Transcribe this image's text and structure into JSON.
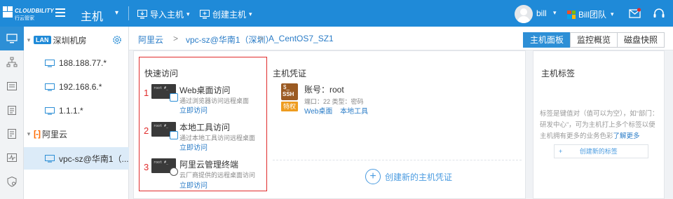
{
  "brand": {
    "name": "CLOUDBILITY",
    "sub": "行云管家"
  },
  "header": {
    "module": "主机",
    "import_host": "导入主机",
    "create_host": "创建主机",
    "user": "bill",
    "team": "Bill团队"
  },
  "tree": {
    "lan_badge": "LAN",
    "lan_group": "深圳机房",
    "lan_hosts": [
      "188.188.77.*",
      "192.168.6.*",
      "1.1.1.*"
    ],
    "cloud_group": "阿里云",
    "cloud_host": "vpc-sz@华南1（..."
  },
  "breadcrumb": {
    "items": [
      "阿里云",
      "vpc-sz@华南1（深圳）",
      "A_CentOS7_SZ1"
    ],
    "sep": ">"
  },
  "view_tabs": [
    "主机面板",
    "监控概览",
    "磁盘快照"
  ],
  "quick_access": {
    "title": "快速访问",
    "terminal_text": "root #_",
    "items": [
      {
        "num": "1",
        "name": "Web桌面访问",
        "desc": "通过浏览器访问远程桌面",
        "link": "立即访问"
      },
      {
        "num": "2",
        "name": "本地工具访问",
        "desc": "通过本地工具访问远程桌面",
        "link": "立即访问"
      },
      {
        "num": "3",
        "name": "阿里云管理终端",
        "desc": "云厂商提供的远程桌面访问",
        "link": "立即访问"
      }
    ]
  },
  "credential": {
    "title": "主机凭证",
    "ssh_prompt": "$_",
    "ssh_label": "SSH",
    "privilege": "特权",
    "account": "账号：root",
    "port_type": "端口：22  类型：密码",
    "link_web": "Web桌面",
    "link_local": "本地工具",
    "add": "创建新的主机凭证"
  },
  "tags": {
    "title": "主机标签",
    "desc": "标签是键值对（值可以为空），如“部门：研发中心”，可为主机打上多个标签以便主机拥有更多的业务色彩",
    "learn_more": "了解更多",
    "create": "创建新的标签",
    "plus": "+"
  },
  "colors": {
    "topbar": "#1f8ad8",
    "accent": "#2d8fd6",
    "link": "#2a7cc7",
    "highlight": "#e02c2c",
    "privilege": "#ee9c1f",
    "ssh": "#9b5a22"
  }
}
